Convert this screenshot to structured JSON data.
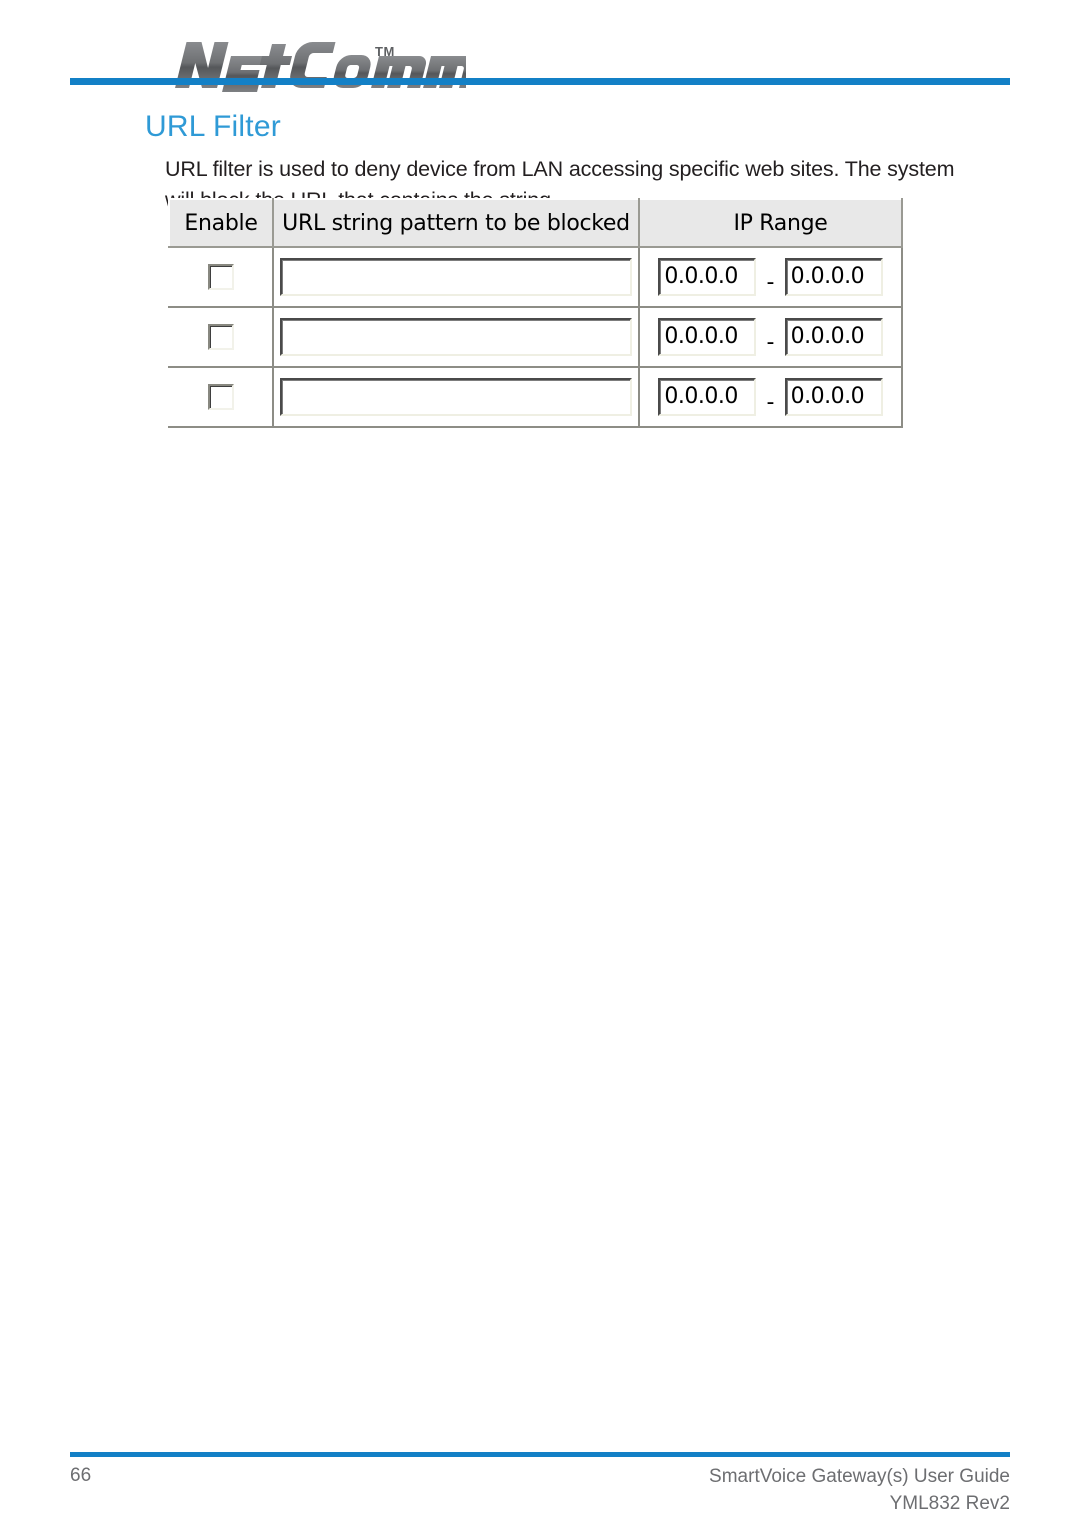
{
  "brand": {
    "logo_text": "NetComm",
    "trademark": "TM",
    "logo_color": "#5e6063",
    "accent_color": "#1380c6"
  },
  "heading": {
    "title": "URL Filter",
    "title_color": "#2f9ad6"
  },
  "body": {
    "paragraph": "URL filter is used to deny device from LAN accessing specific web sites. The system will block the URL that contains the string."
  },
  "form": {
    "columns": [
      {
        "key": "enable",
        "label": "Enable"
      },
      {
        "key": "url",
        "label": "URL string pattern to be blocked"
      },
      {
        "key": "iprange",
        "label": "IP Range"
      }
    ],
    "ip_separator": "-",
    "rows": [
      {
        "enabled": false,
        "url_pattern": "",
        "ip_start": "0.0.0.0",
        "ip_end": "0.0.0.0"
      },
      {
        "enabled": false,
        "url_pattern": "",
        "ip_start": "0.0.0.0",
        "ip_end": "0.0.0.0"
      },
      {
        "enabled": false,
        "url_pattern": "",
        "ip_start": "0.0.0.0",
        "ip_end": "0.0.0.0"
      }
    ]
  },
  "footer": {
    "page_number": "66",
    "guide_title": "SmartVoice Gateway(s) User Guide",
    "doc_code": "YML832 Rev2"
  }
}
